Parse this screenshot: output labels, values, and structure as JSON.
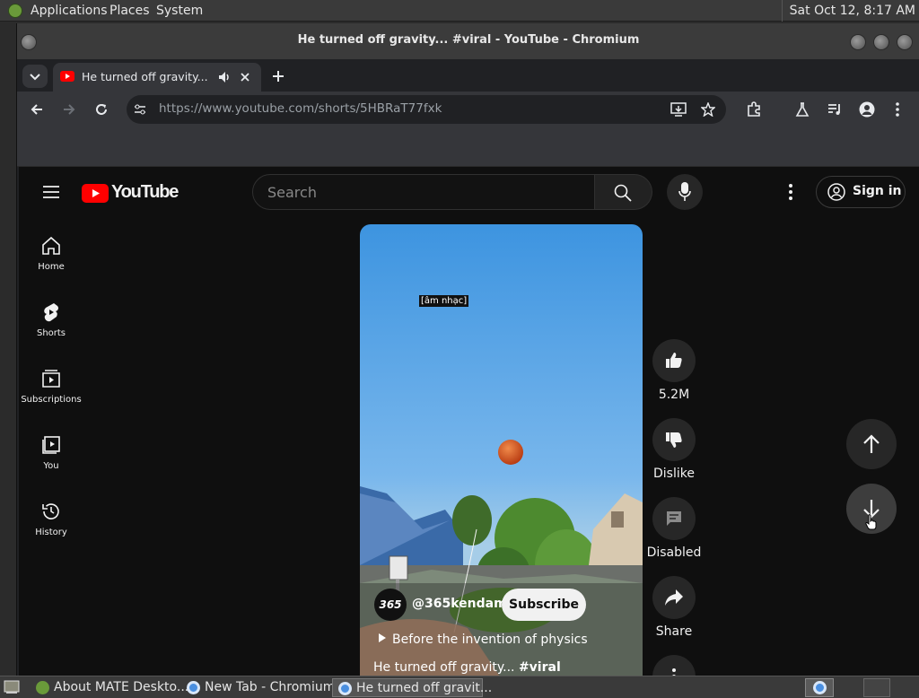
{
  "system_panel": {
    "menus": [
      "Applications",
      "Places",
      "System"
    ],
    "clock": "Sat Oct 12,  8:17 AM"
  },
  "window": {
    "title": "He turned off gravity... #viral - YouTube - Chromium"
  },
  "browser": {
    "tab_title": "He turned off gravity... #",
    "url_host": "https://www.youtube.com",
    "url_path": "/shorts/5HBRaT77fxk"
  },
  "youtube": {
    "logo_text": "YouTube",
    "search_placeholder": "Search",
    "sign_in": "Sign in",
    "sidebar": [
      "Home",
      "Shorts",
      "Subscriptions",
      "You",
      "History"
    ],
    "caption": "[âm nhạc]",
    "channel_handle": "@365kendama",
    "channel_avatar_text": "365",
    "subscribe": "Subscribe",
    "music_track": "Before the invention of physics",
    "short_title_prefix": "He turned off gravity... ",
    "short_title_tag": "#viral",
    "actions": {
      "likes": "5.2M",
      "dislike": "Dislike",
      "comments": "Disabled",
      "share": "Share"
    },
    "brand_color": "#ff0000"
  },
  "taskbar": {
    "items": [
      "About MATE Deskto...",
      "New Tab - Chromium",
      "He turned off gravit..."
    ]
  }
}
